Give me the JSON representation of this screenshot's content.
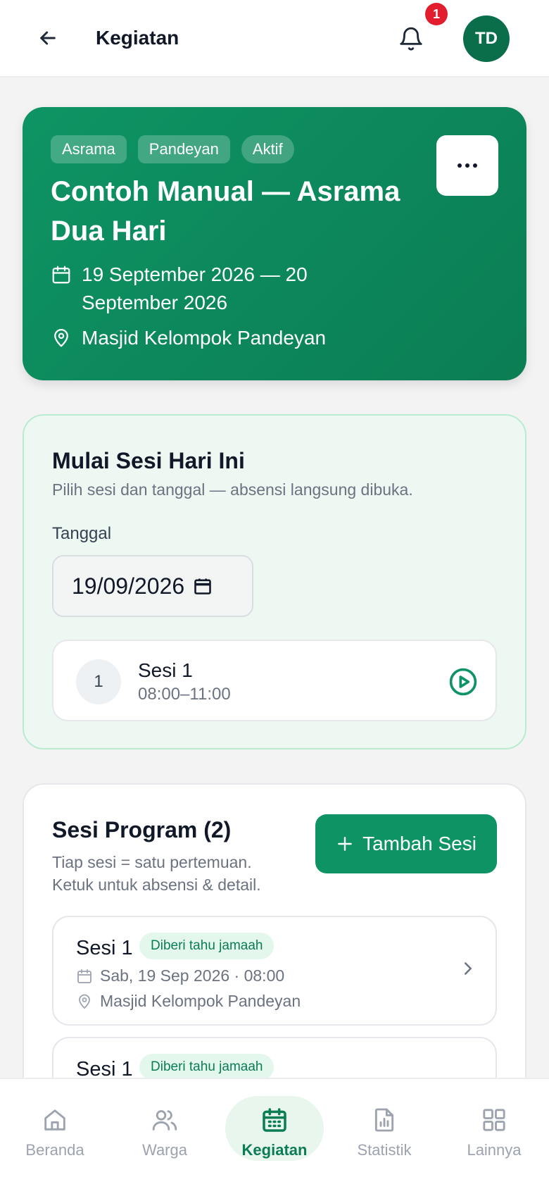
{
  "header": {
    "title": "Kegiatan",
    "notification_count": "1",
    "avatar_initials": "TD"
  },
  "hero": {
    "tags": [
      "Asrama",
      "Pandeyan",
      "Aktif"
    ],
    "title": "Contoh Manual — Asrama Dua Hari",
    "date_range": "19 September 2026 — 20 September 2026",
    "location": "Masjid Kelompok Pandeyan"
  },
  "start_session": {
    "title": "Mulai Sesi Hari Ini",
    "subtitle": "Pilih sesi dan tanggal — absensi langsung dibuka.",
    "date_label": "Tanggal",
    "date_value": "19/09/2026",
    "session": {
      "number": "1",
      "name": "Sesi 1",
      "time": "08:00–11:00"
    }
  },
  "program": {
    "title": "Sesi Program (2)",
    "subtitle": "Tiap sesi = satu pertemuan. Ketuk untuk absensi & detail.",
    "add_label": "Tambah Sesi",
    "sessions": [
      {
        "name": "Sesi 1",
        "badge": "Diberi tahu jamaah",
        "datetime": "Sab, 19 Sep 2026 · 08:00",
        "location": "Masjid Kelompok Pandeyan"
      },
      {
        "name": "Sesi 1",
        "badge": "Diberi tahu jamaah"
      }
    ]
  },
  "nav": {
    "items": [
      {
        "label": "Beranda",
        "icon": "home-icon"
      },
      {
        "label": "Warga",
        "icon": "users-icon"
      },
      {
        "label": "Kegiatan",
        "icon": "calendar-icon"
      },
      {
        "label": "Statistik",
        "icon": "chart-icon"
      },
      {
        "label": "Lainnya",
        "icon": "grid-icon"
      }
    ],
    "active": "Kegiatan"
  },
  "colors": {
    "brand": "#0e9464",
    "brand_dark": "#0b6e4a",
    "badge_red": "#e11d2e"
  }
}
